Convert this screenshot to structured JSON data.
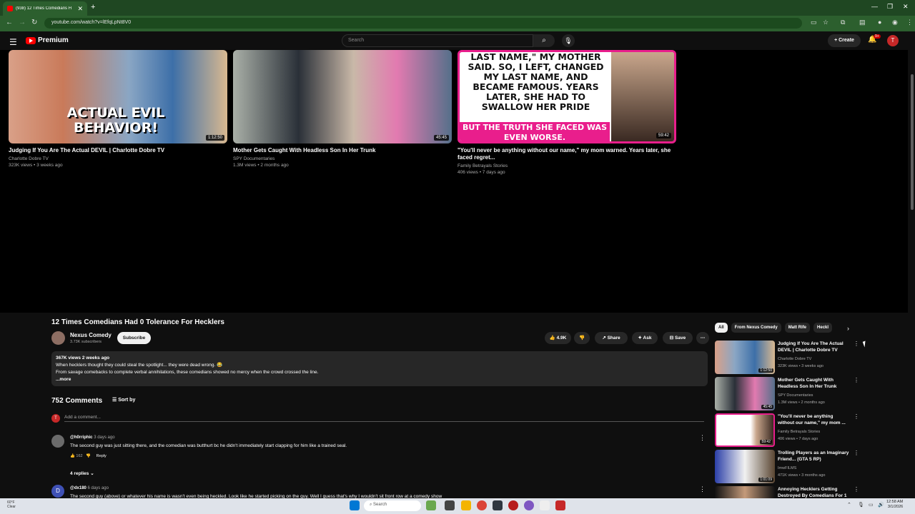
{
  "browser": {
    "tab_title": "(938) 12 Times Comedians H",
    "tab_close": "✕",
    "new_tab": "+",
    "url": "youtube.com/watch?v=lEfqLpNt8V0",
    "window_controls": [
      "—",
      "❐",
      "✕"
    ]
  },
  "header": {
    "brand": "Premium",
    "search_placeholder": "Search",
    "create_label": "Create",
    "notif_badge": "9+",
    "avatar_letter": "T"
  },
  "endscreen": [
    {
      "title": "Judging If You Are The Actual DEVIL | Charlotte Dobre TV",
      "channel": "Charlotte Dobre TV",
      "meta": "323K views • 3 weeks ago",
      "duration": "1:12:50",
      "thumb_text": "ACTUAL EVIL BEHAVIOR!"
    },
    {
      "title": "Mother Gets Caught With Headless Son In Her Trunk",
      "channel": "SPY Documentaries",
      "meta": "1.3M views • 2 months ago",
      "duration": "45:45",
      "thumb_text": ""
    },
    {
      "title": "\"You'll never be anything without our name,\" my mom warned. Years later, she faced regret...",
      "channel": "Family Betrayals Stories",
      "meta": "406 views • 7 days ago",
      "duration": "59:42",
      "thumb_text": "LAST NAME,\" MY MOTHER SAID. SO, I LEFT, CHANGED MY LAST NAME, AND BECAME FAMOUS. YEARS LATER, SHE HAD TO SWALLOW HER PRIDE",
      "thumb_banner": "BUT THE TRUTH SHE FACED WAS EVEN WORSE."
    }
  ],
  "video": {
    "title": "12 Times Comedians Had 0 Tolerance For Hecklers",
    "channel": "Nexus Comedy",
    "subscribers": "3.73K subscribers",
    "subscribe_label": "Subscribe",
    "likes": "4.9K",
    "share_label": "Share",
    "ask_label": "Ask",
    "save_label": "Save",
    "desc_stats": "367K views  2 weeks ago",
    "desc_line1": "When hecklers thought they could steal the spotlight... they were dead wrong. 😂",
    "desc_line2": "From savage comebacks to complete verbal annihilations, these comedians showed no mercy when the crowd crossed the line.",
    "desc_more": "...more"
  },
  "comments": {
    "count_label": "752 Comments",
    "sort_label": "Sort by",
    "add_placeholder": "Add a comment...",
    "items": [
      {
        "user": "@h0rriphic",
        "time": "3 days ago",
        "text": "The second guy was just sitting there, and the comedian was butthurt bc he didn't immediately start clapping for him like a trained seal.",
        "likes": "162",
        "reply": "Reply",
        "replies": "4 replies"
      },
      {
        "user": "@dx180",
        "time": "6 days ago",
        "text": "The second guy (above) or whatever his name is wasn't even being heckled. Look like he started picking on the guy. Well I guess that's why I wouldn't sit front row at a comedy show"
      }
    ]
  },
  "sidebar": {
    "chips": [
      "All",
      "From Nexus Comedy",
      "Matt Rife",
      "Heckl"
    ],
    "items": [
      {
        "title": "Judging If You Are The Actual DEVIL | Charlotte Dobre TV",
        "channel": "Charlotte Dobre TV",
        "meta": "323K views • 3 weeks ago",
        "duration": "1:12:50"
      },
      {
        "title": "Mother Gets Caught With Headless Son In Her Trunk",
        "channel": "SPY Documentaries",
        "meta": "1.3M views • 2 months ago",
        "duration": "45:45"
      },
      {
        "title": "\"You'll never be anything without our name,\" my mom ...",
        "channel": "Family Betrayals Stories",
        "meta": "406 views • 7 days ago",
        "duration": "59:42"
      },
      {
        "title": "Trolling Players as an Imaginary Friend... (GTA 5 RP)",
        "channel": "ImwFILMS",
        "meta": "471K views • 3 months ago",
        "duration": "1:01:09"
      },
      {
        "title": "Annoying Hecklers Getting Destroyed By Comedians For 1",
        "channel": "",
        "meta": "",
        "duration": ""
      }
    ]
  },
  "taskbar": {
    "weather_temp": "60°F",
    "weather_desc": "Clear",
    "search_label": "Search",
    "time": "12:58 AM",
    "date": "3/1/2026"
  },
  "colors": {
    "bg": "#0f0f0f",
    "browser_frame": "#2c5f2e",
    "yt_red": "#ff0000",
    "thumb_pink": "#e91e8c"
  }
}
